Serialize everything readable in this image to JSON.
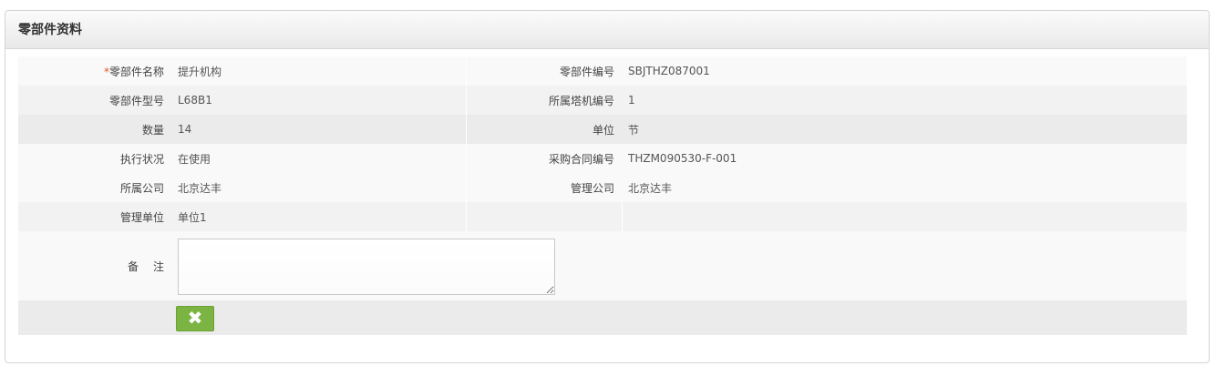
{
  "panel": {
    "title": "零部件资料"
  },
  "form": {
    "required_mark": "*",
    "rows": [
      {
        "left_label": "零部件名称",
        "left_value": "提升机构",
        "right_label": "零部件编号",
        "right_value": "SBJTHZ087001"
      },
      {
        "left_label": "零部件型号",
        "left_value": "L68B1",
        "right_label": "所属塔机编号",
        "right_value": "1"
      },
      {
        "left_label": "数量",
        "left_value": "14",
        "right_label": "单位",
        "right_value": "节"
      },
      {
        "left_label": "执行状况",
        "left_value": "在使用",
        "right_label": "采购合同编号",
        "right_value": "THZM090530-F-001"
      },
      {
        "left_label": "所属公司",
        "left_value": "北京达丰",
        "right_label": "管理公司",
        "right_value": "北京达丰"
      },
      {
        "left_label": "管理单位",
        "left_value": "单位1",
        "right_label": "",
        "right_value": ""
      }
    ],
    "remark_label": "备注",
    "remark_value": ""
  },
  "actions": {
    "close_icon": "close-icon",
    "close_glyph": "✖"
  },
  "colors": {
    "close_button": "#7bb443",
    "required_mark": "#e8541e"
  }
}
